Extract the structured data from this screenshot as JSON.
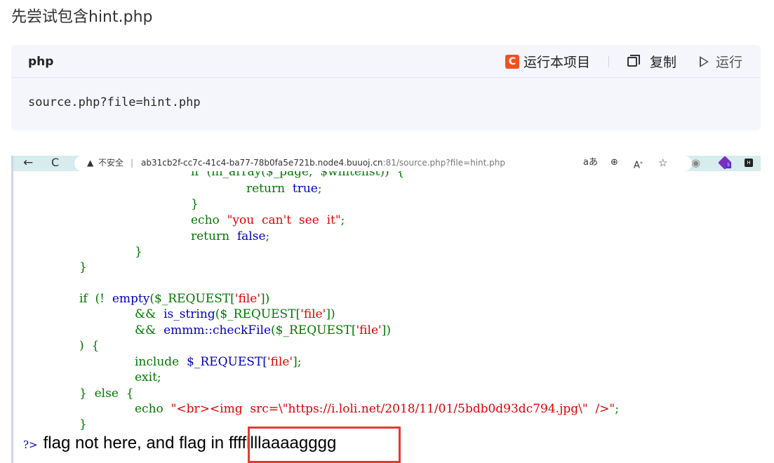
{
  "heading": "先尝试包含hint.php",
  "code_block": {
    "lang": "php",
    "run_project_label": "运行本项目",
    "run_project_logo": "C",
    "copy_label": "复制",
    "run_label": "运行",
    "code": "source.php?file=hint.php"
  },
  "browser": {
    "back_icon": "←",
    "reload_icon": "C",
    "security_label": "不安全",
    "url_main": "ab31cb2f-cc7c-41c4-ba77-78b0fa5e721b.node4.buuoj.cn",
    "url_rest": ":81/source.php?file=hint.php",
    "icons": [
      "read-aloud-icon",
      "zoom-icon",
      "text-size-icon",
      "star-icon",
      "circle-icon",
      "extension-purple-icon",
      "extension-dark-icon"
    ],
    "ext_badge": "5",
    "ext_dark_label": "H"
  },
  "source_lines": {
    "l0": "if  (in_array($_page,  $whitelist))  {",
    "l1_kw": "return",
    "l1_val": "true",
    "l2": "}",
    "l3_kw": "echo",
    "l3_str": "\"you  can't  see  it\"",
    "l4_kw": "return",
    "l4_val": "false",
    "l5": "}",
    "l6": "}",
    "l8_a": "if  (!  ",
    "l8_fn": "empty",
    "l8_b": "($_REQUEST[",
    "l8_str": "'file'",
    "l8_c": "])",
    "l9_a": "&&  ",
    "l9_fn": "is_string",
    "l9_b": "($_REQUEST[",
    "l9_str": "'file'",
    "l9_c": "])",
    "l10_a": "&&  ",
    "l10_fn": "emmm::checkFile",
    "l10_b": "($_REQUEST[",
    "l10_str": "'file'",
    "l10_c": "])",
    "l11": ")  {",
    "l12_kw": "include  ",
    "l12_b": "$_REQUEST[",
    "l12_str": "'file'",
    "l12_c": "];",
    "l13": "exit;",
    "l14_a": "}  ",
    "l14_kw": "else  {",
    "l15_kw": "echo  ",
    "l15_str": "\"<br><img  src=\\\"https://i.loli.net/2018/11/01/5bdb0d93dc794.jpg\\\"  />\"",
    "l15_c": ";",
    "l16": "}"
  },
  "output": {
    "php_close": "?>",
    "text_before": "flag not here, and flag in ",
    "highlighted": "ffffllllaaaagggg"
  },
  "colors": {
    "keyword": "#007700",
    "default": "#0000bb",
    "string": "#dd0000",
    "highlight_box": "#e53935",
    "browser_bar": "#d7ecec"
  }
}
